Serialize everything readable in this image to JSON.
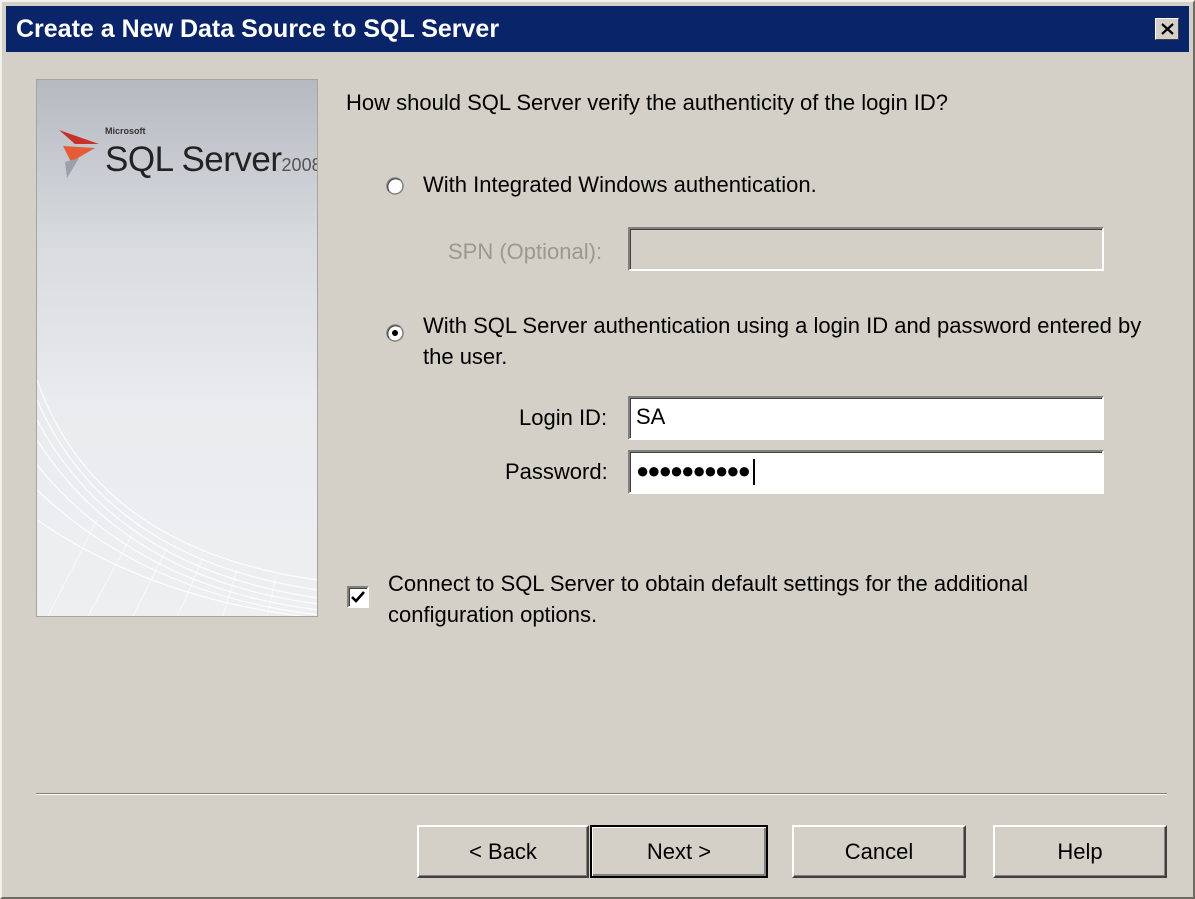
{
  "window": {
    "title": "Create a New Data Source to SQL Server",
    "close_icon": "close-icon"
  },
  "banner": {
    "logo_small": "Microsoft",
    "logo_main": "SQL Server",
    "logo_year": "2008"
  },
  "auth": {
    "question": "How should SQL Server verify the authenticity of the login ID?",
    "option_integrated": "With Integrated Windows authentication.",
    "spn_label": "SPN (Optional):",
    "spn_value": "",
    "option_sql": "With SQL Server authentication using a login ID and password entered by the user.",
    "selected": "sql"
  },
  "credentials": {
    "login_label": "Login ID:",
    "login_value": "SA",
    "password_label": "Password:",
    "password_masked": "●●●●●●●●●●"
  },
  "connect_option": {
    "label": "Connect to SQL Server to obtain default settings for the additional configuration options.",
    "checked": true
  },
  "buttons": {
    "back": "< Back",
    "next": "Next >",
    "cancel": "Cancel",
    "help": "Help"
  },
  "colors": {
    "titlebar": "#0a246a",
    "dialog_bg": "#d4d0c8"
  }
}
